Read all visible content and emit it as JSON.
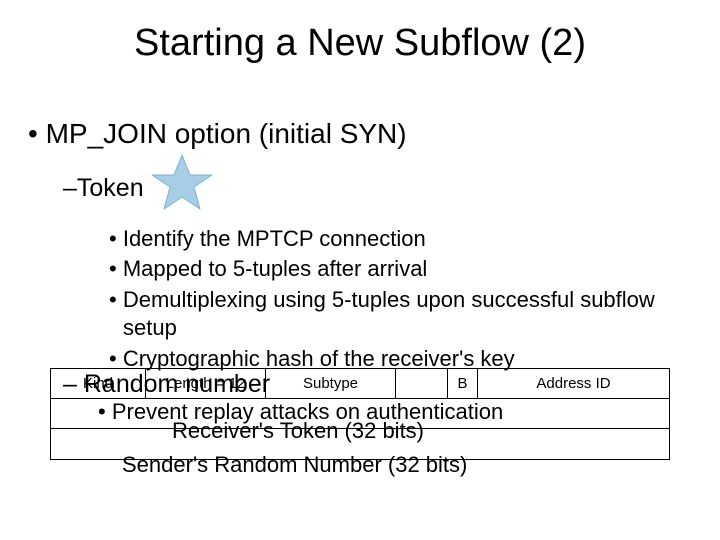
{
  "title": "Starting a New Subflow (2)",
  "bullet_root": "MP_JOIN option (initial SYN)",
  "token": {
    "label": "Token",
    "sub": [
      "Identify the MPTCP connection",
      "Mapped to 5-tuples after arrival",
      "Demultiplexing using 5-tuples upon successful subflow setup",
      "Cryptographic hash of the receiver's key"
    ]
  },
  "random": {
    "label": "Random number",
    "sub": [
      "Prevent replay attacks on authentication"
    ]
  },
  "packet": {
    "row1": {
      "kind": "Kind",
      "length": "Length = 12",
      "subtype": "Subtype",
      "b": "B",
      "address_id": "Address ID"
    },
    "row2": "Receiver's Token (32 bits)",
    "row3": "Sender's Random Number (32 bits)"
  },
  "colors": {
    "star_fill": "#A7CEE5",
    "star_stroke": "#7BB1D6"
  }
}
